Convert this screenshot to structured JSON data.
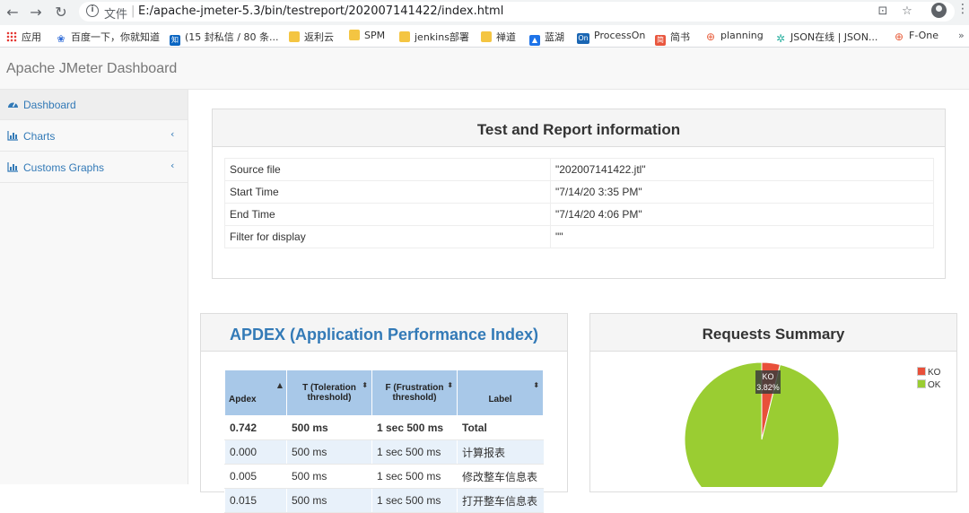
{
  "browser": {
    "info_icon": "info-icon",
    "file_label": "文件",
    "separator": "|",
    "url": "E:/apache-jmeter-5.3/bin/testreport/202007141422/index.html",
    "bookmarks": [
      {
        "label": "应用",
        "icon": "apps-grid-icon"
      },
      {
        "label": "百度一下，你就知道",
        "icon": "baidu-icon",
        "color": "#2f6bd8"
      },
      {
        "label": "(15 封私信 / 80 条...",
        "icon": "zhihu-icon",
        "color": "#0a66c2",
        "glyph": "知"
      },
      {
        "label": "返利云",
        "icon": "folder-icon",
        "color": "#f4c542"
      },
      {
        "label": "SPM",
        "icon": "folder-icon",
        "color": "#f4c542"
      },
      {
        "label": "jenkins部署",
        "icon": "folder-icon",
        "color": "#f4c542"
      },
      {
        "label": "禅道",
        "icon": "folder-icon",
        "color": "#f4c542"
      },
      {
        "label": "蓝湖",
        "icon": "lanhu-icon",
        "color": "#1e73e8"
      },
      {
        "label": "ProcessOn",
        "icon": "processon-icon",
        "color": "#1a66b3",
        "glyph": "On"
      },
      {
        "label": "简书",
        "icon": "jianshu-icon",
        "color": "#e9573f",
        "glyph": "简"
      },
      {
        "label": "planning",
        "icon": "planning-icon",
        "color": "#e85d3a"
      },
      {
        "label": "JSON在线 | JSON...",
        "icon": "json-icon",
        "color": "#2bb0a0"
      },
      {
        "label": "F-One",
        "icon": "fone-icon",
        "color": "#e85d3a"
      }
    ]
  },
  "app": {
    "title": "Apache JMeter Dashboard"
  },
  "sidebar": {
    "items": [
      {
        "label": "Dashboard",
        "icon": "dashboard-icon"
      },
      {
        "label": "Charts",
        "icon": "bar-chart-icon"
      },
      {
        "label": "Customs Graphs",
        "icon": "bar-chart-icon"
      }
    ],
    "chevron": "‹"
  },
  "test_info": {
    "title": "Test and Report information",
    "rows": [
      {
        "label": "Source file",
        "value": "\"202007141422.jtl\""
      },
      {
        "label": "Start Time",
        "value": "\"7/14/20 3:35 PM\""
      },
      {
        "label": "End Time",
        "value": "\"7/14/20 4:06 PM\""
      },
      {
        "label": "Filter for display",
        "value": "\"\""
      }
    ]
  },
  "apdex": {
    "title": "APDEX (Application Performance Index)",
    "headers": [
      "Apdex",
      "T (Toleration threshold)",
      "F (Frustration threshold)",
      "Label"
    ],
    "rows": [
      [
        "0.742",
        "500 ms",
        "1 sec 500 ms",
        "Total"
      ],
      [
        "0.000",
        "500 ms",
        "1 sec 500 ms",
        "计算报表"
      ],
      [
        "0.005",
        "500 ms",
        "1 sec 500 ms",
        "修改整车信息表"
      ],
      [
        "0.015",
        "500 ms",
        "1 sec 500 ms",
        "打开整车信息表"
      ]
    ]
  },
  "requests_summary": {
    "title": "Requests Summary",
    "legend": [
      {
        "label": "KO",
        "color": "#e8503a"
      },
      {
        "label": "OK",
        "color": "#9acd32"
      }
    ],
    "ko_label": "KO",
    "ko_percent_label": "3.82%"
  },
  "chart_data": {
    "type": "pie",
    "title": "Requests Summary",
    "categories": [
      "KO",
      "OK"
    ],
    "values": [
      3.82,
      96.18
    ],
    "colors": [
      "#e8503a",
      "#9acd32"
    ],
    "legend_position": "top-right"
  }
}
